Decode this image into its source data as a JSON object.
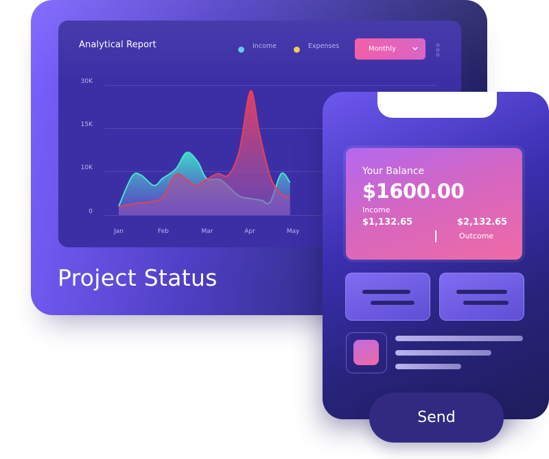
{
  "report": {
    "title": "Analytical Report",
    "legend": [
      {
        "label": "Income",
        "color": "#5cc8f2"
      },
      {
        "label": "Expenses",
        "color": "#f2c94c"
      }
    ],
    "period": "Monthly",
    "period_icon": "chevron-down-icon",
    "menu_icon": "more-vertical-icon"
  },
  "chart_data": {
    "type": "area",
    "x": [
      "Jan",
      "Feb",
      "Mar",
      "Apr",
      "May"
    ],
    "y_ticks": [
      "30K",
      "15K",
      "10K",
      "0"
    ],
    "series": [
      {
        "name": "Income",
        "color": "#3fd6c8",
        "points": [
          [
            0,
            1.5
          ],
          [
            0.3,
            6.5
          ],
          [
            0.5,
            6.8
          ],
          [
            0.8,
            5.0
          ],
          [
            1.0,
            6.2
          ],
          [
            1.3,
            7.8
          ],
          [
            1.55,
            10.6
          ],
          [
            1.8,
            9.0
          ],
          [
            2.0,
            6.2
          ],
          [
            2.3,
            6.0
          ],
          [
            2.5,
            4.8
          ],
          [
            2.75,
            3.2
          ],
          [
            3.0,
            2.8
          ],
          [
            3.25,
            2.5
          ],
          [
            3.45,
            2.2
          ],
          [
            3.7,
            7.0
          ],
          [
            3.9,
            5.5
          ]
        ]
      },
      {
        "name": "Expenses",
        "color": "#e0455f",
        "points": [
          [
            0,
            1.4
          ],
          [
            0.4,
            2.0
          ],
          [
            0.7,
            2.2
          ],
          [
            1.0,
            3.0
          ],
          [
            1.3,
            6.8
          ],
          [
            1.55,
            6.0
          ],
          [
            1.75,
            5.0
          ],
          [
            2.0,
            6.0
          ],
          [
            2.25,
            7.0
          ],
          [
            2.5,
            6.8
          ],
          [
            2.75,
            11.0
          ],
          [
            3.0,
            21.0
          ],
          [
            3.2,
            14.0
          ],
          [
            3.45,
            6.5
          ],
          [
            3.7,
            3.5
          ],
          [
            3.9,
            3.2
          ]
        ]
      }
    ],
    "ylim": [
      0,
      22
    ]
  },
  "tablet_caption": "Project Status",
  "balance": {
    "label": "Your Balance",
    "amount": "$1600.00",
    "income_label": "Income",
    "income_value": "$1,132.65",
    "outcome_value": "$2,132.65",
    "outcome_label": "Outcome"
  },
  "send_label": "Send"
}
